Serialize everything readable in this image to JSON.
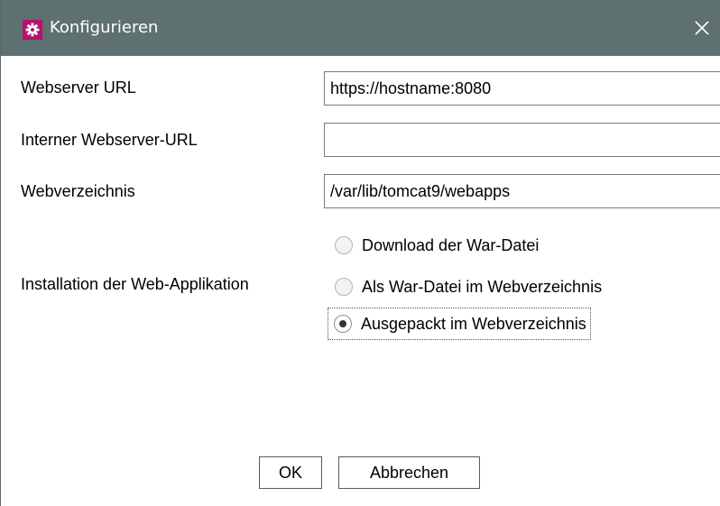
{
  "window": {
    "title": "Konfigurieren",
    "title_icon": "gear-icon",
    "close_glyph": "✕"
  },
  "form": {
    "webserver_url": {
      "label": "Webserver URL",
      "value": "https://hostname:8080"
    },
    "internal_url": {
      "label": "Interner Webserver-URL",
      "value": ""
    },
    "webdir": {
      "label": "Webverzeichnis",
      "value": "/var/lib/tomcat9/webapps"
    },
    "install": {
      "label": "Installation der Web-Applikation",
      "options": [
        {
          "label": "Download der War-Datei",
          "selected": false
        },
        {
          "label": "Als War-Datei im Webverzeichnis",
          "selected": false
        },
        {
          "label": "Ausgepackt im Webverzeichnis",
          "selected": true
        }
      ]
    }
  },
  "buttons": {
    "ok": "OK",
    "cancel": "Abbrechen"
  },
  "colors": {
    "titlebar": "#5e7070",
    "title_icon_bg": "#b8106e"
  }
}
